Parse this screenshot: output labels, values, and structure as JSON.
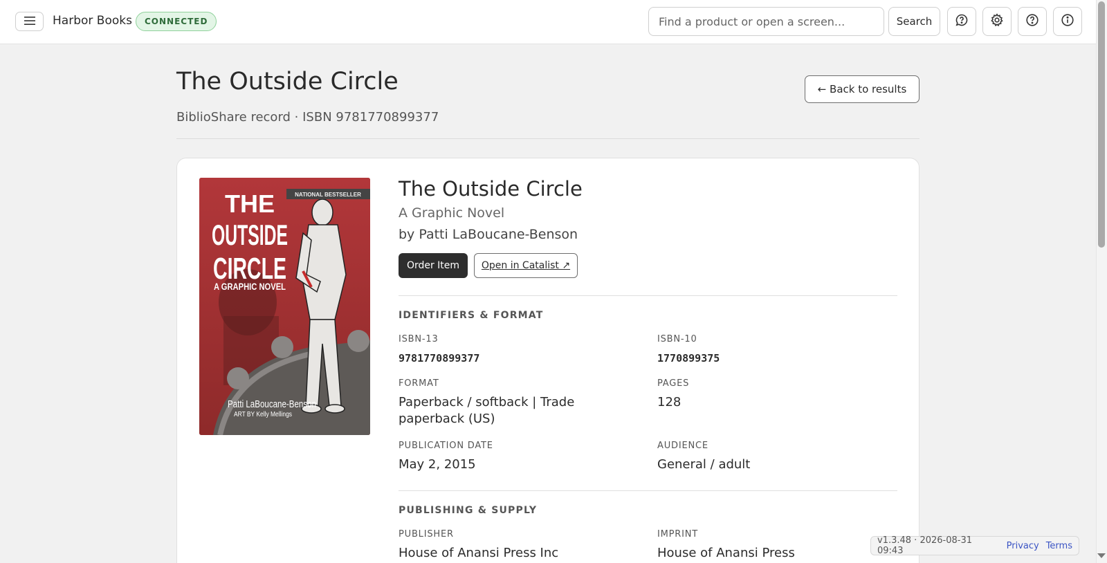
{
  "header": {
    "app_name": "Harbor Books",
    "status": "CONNECTED",
    "search_placeholder": "Find a product or open a screen...",
    "search_label": "Search",
    "icons": [
      "menu-icon",
      "feedback-icon",
      "gear-icon",
      "help-icon",
      "info-icon"
    ]
  },
  "page": {
    "title": "The Outside Circle",
    "subtitle": "BiblioShare record · ISBN 9781770899377",
    "back_label": "← Back to results"
  },
  "book": {
    "title": "The Outside Circle",
    "subtitle": "A Graphic Novel",
    "author": "by Patti LaBoucane-Benson",
    "order_label": "Order Item",
    "catalist_label": "Open in Catalist ↗",
    "cover": {
      "banner": "NATIONAL BESTSELLER",
      "line1": "THE",
      "line2": "OUTSIDE",
      "line3": "CIRCLE",
      "line4": "A GRAPHIC NOVEL",
      "author": "Patti LaBoucane-Benson",
      "art": "ART BY Kelly Mellings"
    }
  },
  "identifiers": {
    "heading": "IDENTIFIERS & FORMAT",
    "isbn13_label": "ISBN-13",
    "isbn13": "9781770899377",
    "isbn10_label": "ISBN-10",
    "isbn10": "1770899375",
    "format_label": "FORMAT",
    "format": "Paperback / softback | Trade paperback (US)",
    "pages_label": "PAGES",
    "pages": "128",
    "pubdate_label": "PUBLICATION DATE",
    "pubdate": "May 2, 2015",
    "audience_label": "AUDIENCE",
    "audience": "General / adult"
  },
  "publishing": {
    "heading": "PUBLISHING & SUPPLY",
    "publisher_label": "PUBLISHER",
    "publisher": "House of Anansi Press Inc",
    "imprint_label": "IMPRINT",
    "imprint": "House of Anansi Press"
  },
  "footer": {
    "version": "v1.3.48 · 2026-08-31 09:43",
    "privacy": "Privacy",
    "terms": "Terms"
  }
}
